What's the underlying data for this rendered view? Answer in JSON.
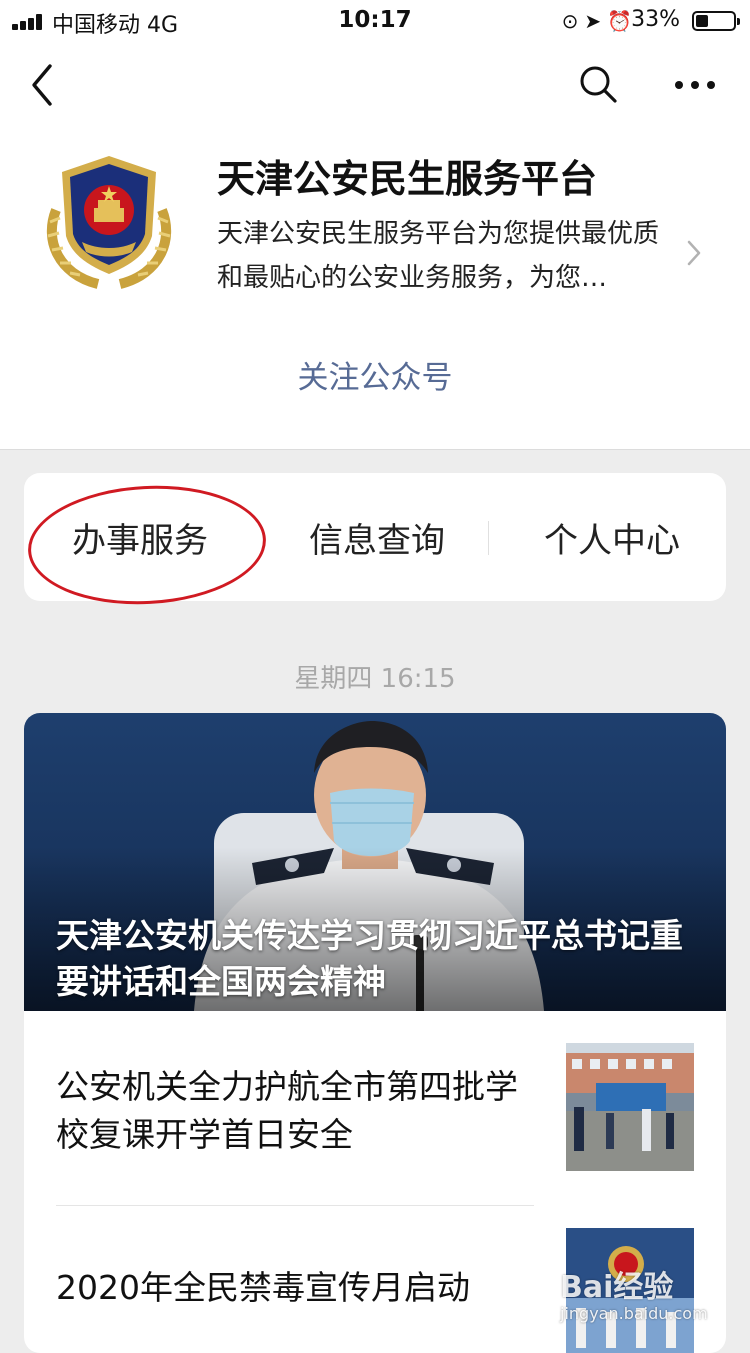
{
  "status_bar": {
    "carrier": "中国移动  4G",
    "time": "10:17",
    "battery": "33%",
    "battery_level": 0.33,
    "icons": [
      "orientation-lock-icon",
      "location-icon",
      "alarm-icon"
    ]
  },
  "nav": {
    "back_icon": "chevron-left-icon",
    "search_icon": "search-icon",
    "more_icon": "more-icon"
  },
  "profile": {
    "name": "天津公安民生服务平台",
    "description": "天津公安民生服务平台为您提供最优质和最贴心的公安业务服务，为您…",
    "follow_label": "关注公众号"
  },
  "menu": {
    "items": [
      {
        "label": "办事服务"
      },
      {
        "label": "信息查询"
      },
      {
        "label": "个人中心"
      }
    ]
  },
  "feed": {
    "timestamp": "星期四 16:15",
    "hero": {
      "title": "天津公安机关传达学习贯彻习近平总书记重要讲话和全国两会精神"
    },
    "articles": [
      {
        "title": "公安机关全力护航全市第四批学校复课开学首日安全"
      },
      {
        "title": "2020年全民禁毒宣传月启动"
      }
    ]
  },
  "watermark": {
    "brand": "Bai经验",
    "site": "jingyan.baidu.com"
  },
  "colors": {
    "link": "#576b95",
    "highlight": "#d01a22",
    "background": "#ededed"
  }
}
